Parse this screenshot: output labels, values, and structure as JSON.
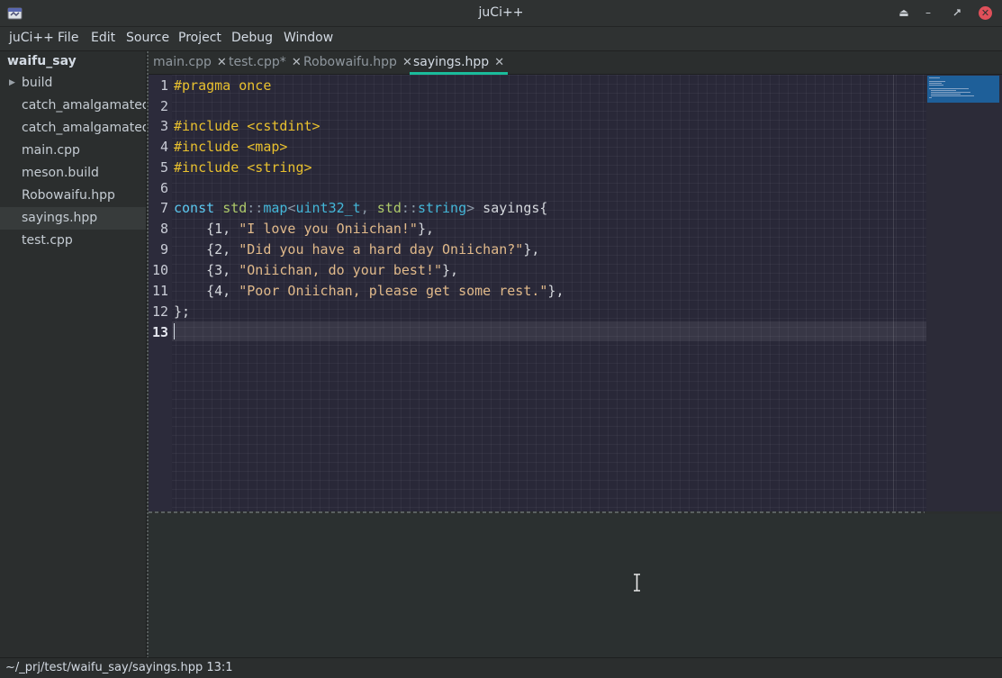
{
  "window": {
    "title": "juCi++",
    "controls": [
      "eject-icon",
      "minimize-icon",
      "restore-icon",
      "close-icon"
    ]
  },
  "menubar": {
    "items": [
      "juCi++",
      "File",
      "Edit",
      "Source",
      "Project",
      "Debug",
      "Window"
    ]
  },
  "sidebar": {
    "project": "waifu_say",
    "items": [
      {
        "label": "build",
        "type": "folder",
        "expander": "▶"
      },
      {
        "label": "catch_amalgamated.cpp",
        "type": "file"
      },
      {
        "label": "catch_amalgamated.hpp",
        "type": "file"
      },
      {
        "label": "main.cpp",
        "type": "file"
      },
      {
        "label": "meson.build",
        "type": "file"
      },
      {
        "label": "Robowaifu.hpp",
        "type": "file"
      },
      {
        "label": "sayings.hpp",
        "type": "file",
        "selected": true
      },
      {
        "label": "test.cpp",
        "type": "file"
      }
    ]
  },
  "tabs": {
    "items": [
      {
        "label": "main.cpp",
        "close": "✕"
      },
      {
        "label": "test.cpp*",
        "close": "✕"
      },
      {
        "label": "Robowaifu.hpp",
        "close": "✕"
      },
      {
        "label": "sayings.hpp",
        "close": "✕",
        "active": true
      }
    ]
  },
  "editor": {
    "line_numbers": [
      "1",
      "2",
      "3",
      "4",
      "5",
      "6",
      "7",
      "8",
      "9",
      "10",
      "11",
      "12",
      "13"
    ],
    "current_line": 13,
    "code": {
      "l1": {
        "pp": "#pragma once"
      },
      "l3": {
        "pp": "#include <cstdint>"
      },
      "l4": {
        "pp": "#include <map>"
      },
      "l5": {
        "pp": "#include <string>"
      },
      "l7": {
        "kw": "const",
        "sp1": " ",
        "ns1": "std",
        "sep1": "::",
        "ty1": "map",
        "lt": "<",
        "ty2": "uint32_t",
        "comma": ", ",
        "ns2": "std",
        "sep2": "::",
        "ty3": "string",
        "gt": ">",
        "rest": " sayings{"
      },
      "l8": {
        "pre": "    {1, ",
        "str": "\"I love you Oniichan!\"",
        "post": "},"
      },
      "l9": {
        "pre": "    {2, ",
        "str": "\"Did you have a hard day Oniichan?\"",
        "post": "},"
      },
      "l10": {
        "pre": "    {3, ",
        "str": "\"Oniichan, do your best!\"",
        "post": "},"
      },
      "l11": {
        "pre": "    {4, ",
        "str": "\"Poor Oniichan, please get some rest.\"",
        "post": "},"
      },
      "l12": {
        "text": "};"
      }
    }
  },
  "statusbar": {
    "text": "~/_prj/test/waifu_say/sayings.hpp 13:1"
  },
  "colors": {
    "tab_accent": "#1abc9c",
    "editor_bg": "#292838",
    "close_button": "#e0505a",
    "keyword": "#5bc8f0",
    "preprocessor": "#e8c02e",
    "string": "#e0b98a"
  }
}
